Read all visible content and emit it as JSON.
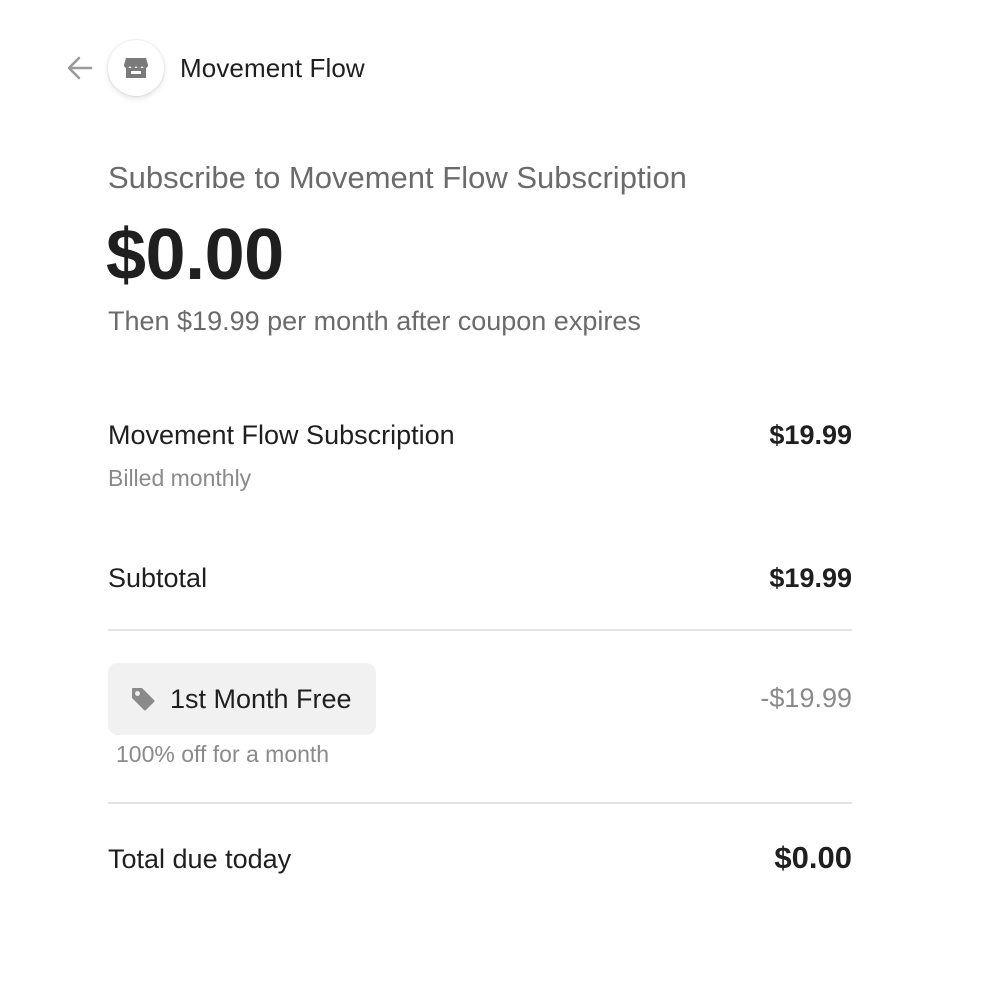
{
  "header": {
    "back_icon": "arrow-left-icon",
    "store_icon": "storefront-icon",
    "merchant_name": "Movement Flow"
  },
  "summary": {
    "subscribe_title": "Subscribe to Movement Flow Subscription",
    "amount_due": "$0.00",
    "then_text": "Then $19.99 per month after coupon expires"
  },
  "line_item": {
    "name": "Movement Flow Subscription",
    "price": "$19.99",
    "billing": "Billed monthly"
  },
  "subtotal": {
    "label": "Subtotal",
    "amount": "$19.99"
  },
  "promotion": {
    "icon": "tag-icon",
    "code_label": "1st Month Free",
    "description": "100% off for a month",
    "discount": "-$19.99"
  },
  "total": {
    "label": "Total due today",
    "amount": "$0.00"
  },
  "colors": {
    "text_primary": "#1f1f1f",
    "text_secondary": "#6b6b6b",
    "text_muted": "#8a8a8a",
    "divider": "#e3e3e3",
    "chip_background": "#f1f1f1",
    "icon_gray": "#8a8a8a"
  }
}
